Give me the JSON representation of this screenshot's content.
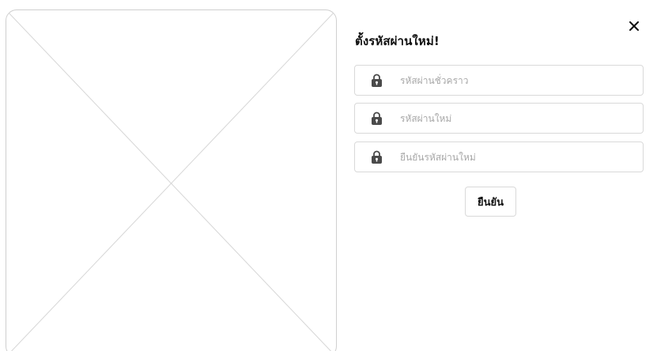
{
  "dialog": {
    "title": "ตั้งรหัสผ่านใหม่!",
    "close_icon": "close-icon",
    "fields": [
      {
        "icon": "lock-icon",
        "value": "",
        "placeholder": "รหัสผ่านชั่วคราว"
      },
      {
        "icon": "lock-icon",
        "value": "",
        "placeholder": "รหัสผ่านใหม่"
      },
      {
        "icon": "lock-icon",
        "value": "",
        "placeholder": "ยืนยันรหัสผ่านใหม่"
      }
    ],
    "confirm_label": "ยืนยัน"
  },
  "colors": {
    "border": "#d9d9d9",
    "placeholder": "#a8a8a8",
    "text": "#111111",
    "icon": "#4a4a4a"
  }
}
